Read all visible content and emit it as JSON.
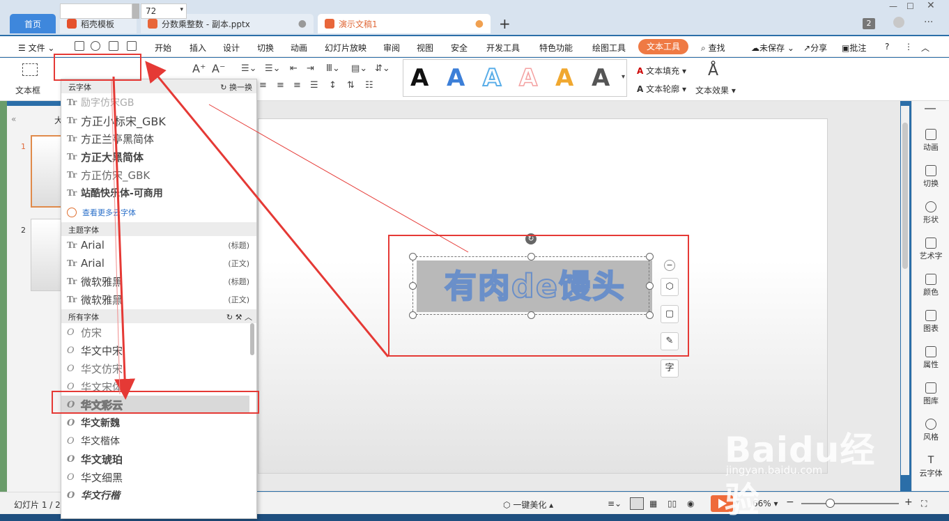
{
  "titlebar": {
    "tabs": [
      {
        "label": "首页"
      },
      {
        "label": "稻壳模板"
      },
      {
        "label": "分数乘整数 - 副本.pptx"
      },
      {
        "label": "演示文稿1"
      }
    ],
    "tab_count_badge": "2"
  },
  "menu": {
    "file": "文件",
    "items": [
      "开始",
      "插入",
      "设计",
      "切换",
      "动画",
      "幻灯片放映",
      "审阅",
      "视图",
      "安全",
      "开发工具",
      "特色功能",
      "绘图工具"
    ],
    "active": "文本工具",
    "search": "查找",
    "unsaved": "未保存",
    "share": "分享",
    "comment": "批注"
  },
  "ribbon": {
    "textbox_label": "文本框",
    "font_name_value": "",
    "font_size_value": "72",
    "text_fill": "文本填充",
    "text_outline": "文本轮廓",
    "text_effect": "文本效果",
    "style_letter": "A",
    "style_colors": [
      "#111111",
      "#3c7fd8",
      "#5aaee8",
      "#f4a0a0",
      "#f0a830",
      "#555555"
    ]
  },
  "font_dropdown": {
    "cloud_section": "云字体",
    "cloud_action": "换一换",
    "cloud_fonts": [
      "励字仿宋GB",
      "方正小标宋_GBK",
      "方正兰亭黑简体",
      "方正大黑简体",
      "方正仿宋_GBK",
      "站酷快乐体-可商用"
    ],
    "more_link": "查看更多云字体",
    "theme_section": "主题字体",
    "theme_fonts": [
      {
        "name": "Arial",
        "tag": "(标题)"
      },
      {
        "name": "Arial",
        "tag": "(正文)"
      },
      {
        "name": "微软雅黑",
        "tag": "(标题)"
      },
      {
        "name": "微软雅黑",
        "tag": "(正文)"
      }
    ],
    "all_section": "所有字体",
    "all_fonts": [
      "仿宋",
      "华文中宋",
      "华文仿宋",
      "华文宋体",
      "华文彩云",
      "华文新魏",
      "华文楷体",
      "华文琥珀",
      "华文细黑",
      "华文行楷"
    ],
    "highlighted": "华文彩云"
  },
  "slides": {
    "numbers": [
      "1",
      "2"
    ],
    "pane_label": "大"
  },
  "canvas": {
    "wordart_text": "有肉de馒头"
  },
  "right_panel": {
    "items": [
      "动画",
      "切换",
      "形状",
      "艺术字",
      "颜色",
      "图表",
      "属性",
      "图库",
      "风格",
      "云字体"
    ]
  },
  "statusbar": {
    "slide_info": "幻灯片 1 / 2",
    "beautify": "一键美化",
    "zoom": "66%"
  },
  "watermark": {
    "logo": "Baidu经验",
    "url": "jingyan.baidu.com"
  },
  "colors": {
    "accent": "#ef7a44",
    "annotation": "#e53935",
    "tab_home": "#3e87dc"
  }
}
